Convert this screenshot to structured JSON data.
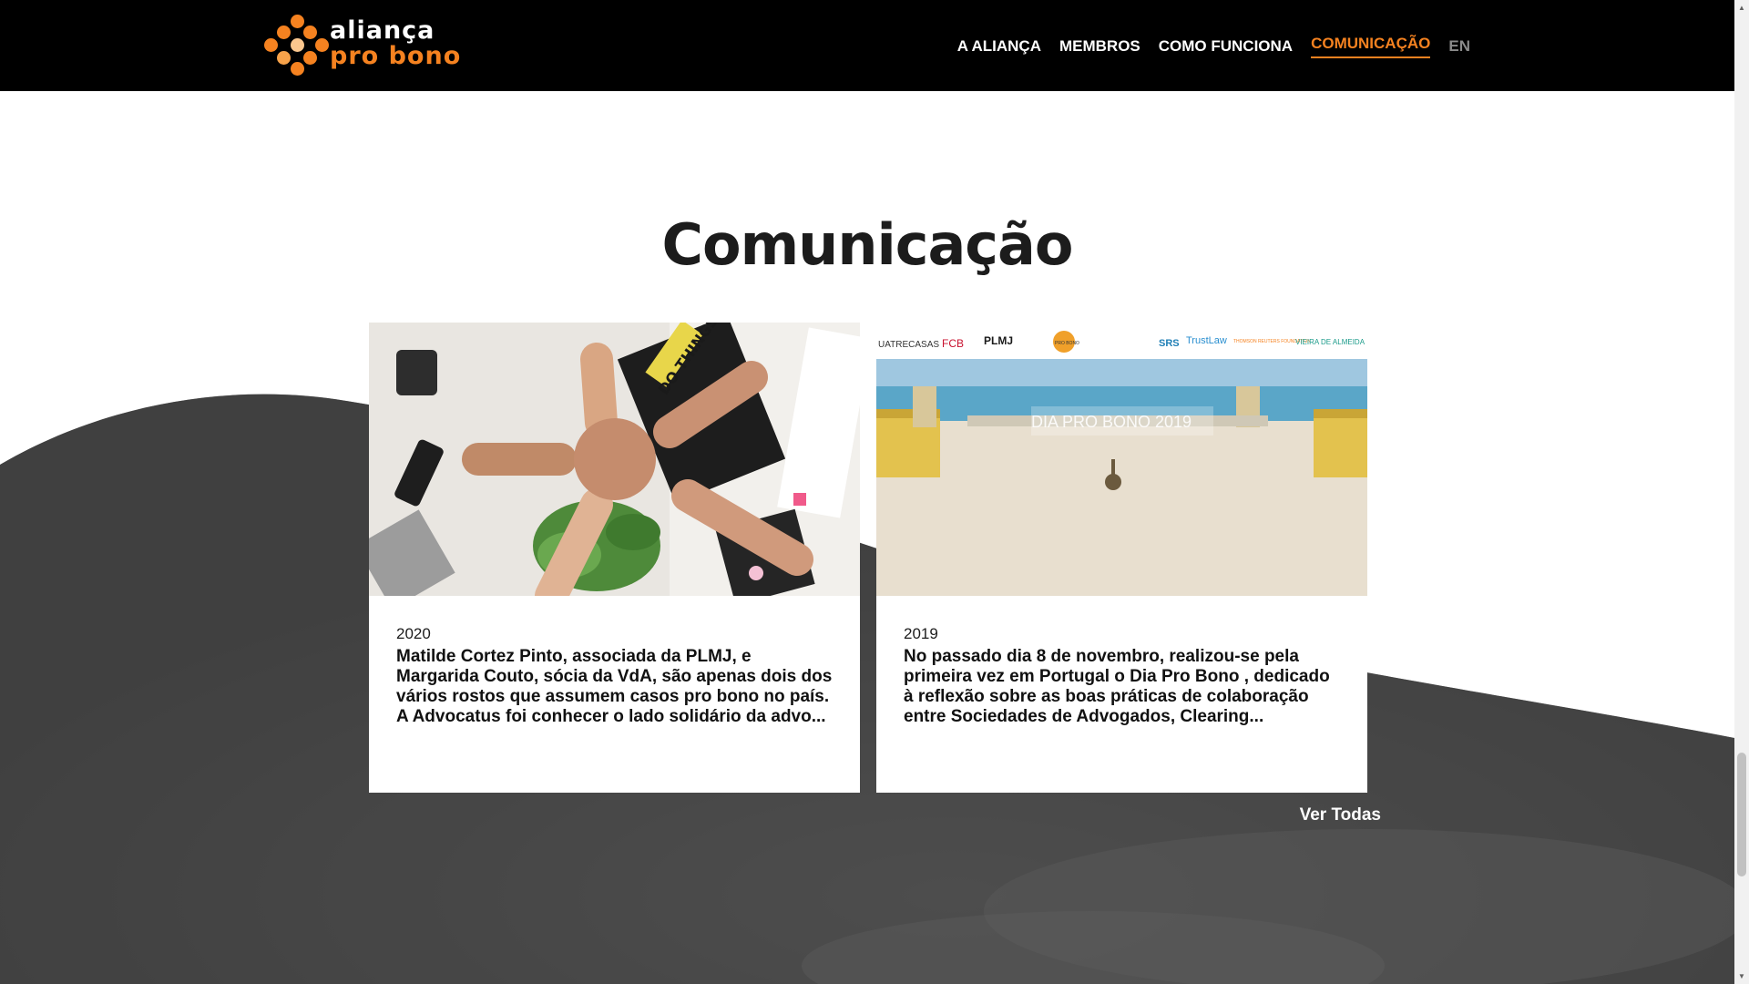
{
  "logo": {
    "line1": "aliança",
    "line2": "pro bono"
  },
  "nav": {
    "items": [
      {
        "label": "A ALIANÇA",
        "active": false
      },
      {
        "label": "MEMBROS",
        "active": false
      },
      {
        "label": "COMO FUNCIONA",
        "active": false
      },
      {
        "label": "COMUNICAÇÃO",
        "active": true
      }
    ],
    "lang": "EN"
  },
  "section": {
    "title": "Comunicação"
  },
  "cards": [
    {
      "year": "2020",
      "text": "Matilde Cortez Pinto, associada da PLMJ, e Margarida Couto, sócia da VdA, são apenas dois dos vários rostos que assumem casos pro bono no país. A Advocatus foi conhecer o lado solidário da advo...",
      "image": {
        "sticker_text": "DO THINGS"
      }
    },
    {
      "year": "2019",
      "text": "No passado dia 8 de novembro, realizou-se pela primeira vez em Portugal o  Dia Pro Bono , dedicado à reflexão sobre as boas práticas de colaboração entre Sociedades de Advogados, Clearing...",
      "image": {
        "banner_title": "DIA PRO BONO 2019",
        "sponsors": [
          "UATRECASAS",
          "FCB",
          "PLMJ",
          "PRO BONO",
          "",
          "SRS",
          "TrustLaw",
          "THOMSON REUTERS FOUNDATION",
          "VIEIRA DE ALMEIDA"
        ]
      }
    }
  ],
  "more_link": "Ver Todas",
  "colors": {
    "accent": "#f58220",
    "header_bg": "#000000",
    "wave": "#4a4a4a"
  }
}
